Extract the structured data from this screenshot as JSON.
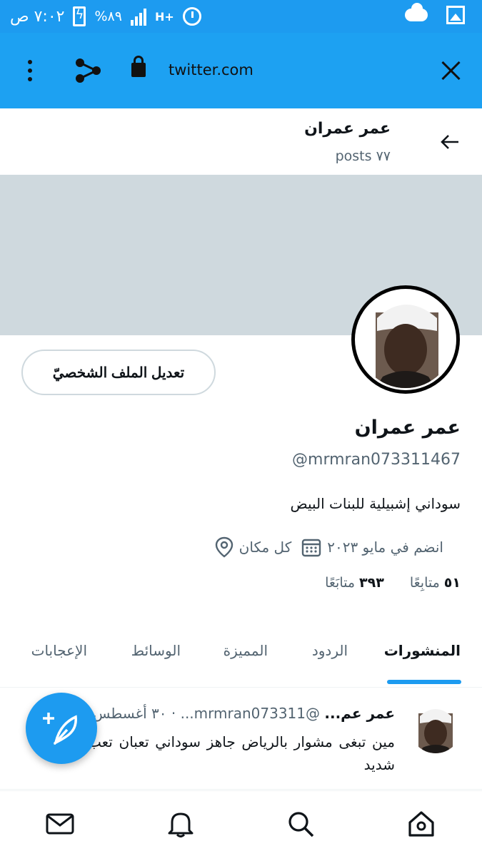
{
  "status_bar": {
    "time": "٧:٠٢ ص",
    "battery": "%٨٩",
    "network": "H+",
    "icons": [
      "alarm-icon",
      "signal-icon",
      "battery-icon",
      "cloud-icon",
      "gallery-icon"
    ]
  },
  "browser": {
    "url": "twitter.com",
    "icons": [
      "more-vertical-icon",
      "share-icon",
      "lock-icon",
      "close-icon"
    ]
  },
  "profile_header": {
    "name": "عمر عمران",
    "posts_count": "٧٧ posts"
  },
  "profile": {
    "edit_button": "تعديل الملف الشخصيّ",
    "name": "عمر عمران",
    "handle": "@mrmran073311467",
    "bio": "سوداني  إشبيلية للبنات البيض",
    "location": "كل مكان",
    "joined": "انضم في مايو ٢٠٢٣",
    "following_count": "٣٩٣",
    "following_label": "متابَعًا",
    "followers_count": "٥١",
    "followers_label": "متابِعًا"
  },
  "tabs": [
    {
      "label": "المنشورات",
      "active": true
    },
    {
      "label": "الردود",
      "active": false
    },
    {
      "label": "المميزة",
      "active": false
    },
    {
      "label": "الوسائط",
      "active": false
    },
    {
      "label": "الإعجابات",
      "active": false
    }
  ],
  "post": {
    "name": "عمر عم...",
    "handle": "@mrmran073311...",
    "date": "٣٠ أغسطس",
    "text": "مين تبغى مشوار بالرياض جاهز سوداني تعبان تعب شديد"
  },
  "bottom_nav": [
    "home-icon",
    "search-icon",
    "notifications-icon",
    "messages-icon"
  ],
  "colors": {
    "accent": "#1d9bf0",
    "banner": "#cfd9de",
    "secondary_text": "#536471"
  }
}
